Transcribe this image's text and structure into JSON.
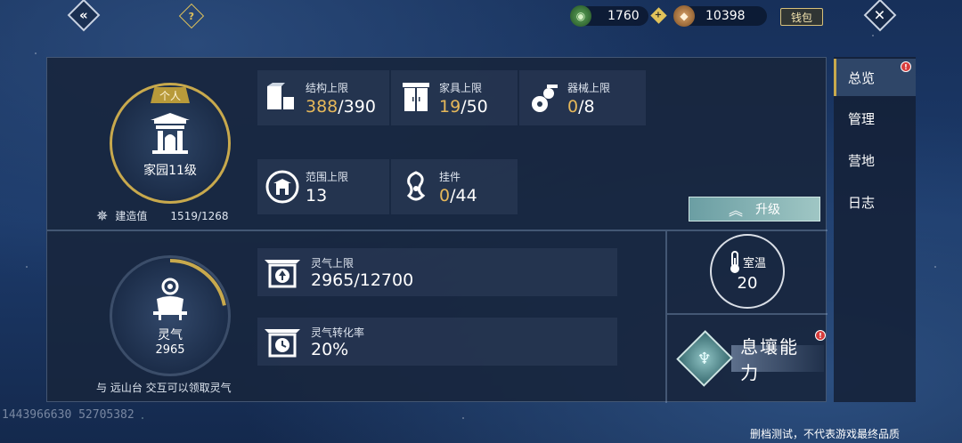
{
  "topbar": {
    "jade_amount": "1760",
    "bean_amount": "10398",
    "wallet_label": "钱包",
    "help_glyph": "?"
  },
  "home": {
    "tag": "个人",
    "level_label": "家园11级",
    "build_label": "建造值",
    "build_value": "1519/1268"
  },
  "stats": {
    "structure": {
      "label": "结构上限",
      "current": "388",
      "max": "/390"
    },
    "furniture": {
      "label": "家具上限",
      "current": "19",
      "max": "/50"
    },
    "machine": {
      "label": "器械上限",
      "current": "0",
      "max": "/8"
    },
    "range": {
      "label": "范围上限",
      "value": "13"
    },
    "pendant": {
      "label": "挂件",
      "current": "0",
      "max": "/44"
    }
  },
  "upgrade": {
    "label": "升级"
  },
  "spirit": {
    "label": "灵气",
    "value": "2965",
    "fill_fraction": 0.22,
    "hint": "与 远山台 交互可以领取灵气",
    "cap_label": "灵气上限",
    "cap_value": "2965/12700",
    "rate_label": "灵气转化率",
    "rate_value": "20%"
  },
  "temperature": {
    "label": "室温",
    "value": "20"
  },
  "ability": {
    "label": "息壤能力"
  },
  "tabs": [
    {
      "label": "总览",
      "active": true
    },
    {
      "label": "管理",
      "active": false
    },
    {
      "label": "营地",
      "active": false
    },
    {
      "label": "日志",
      "active": false
    }
  ],
  "footer": {
    "id": "1443966630 52705382",
    "note": "删档测试，不代表游戏最终品质"
  },
  "colors": {
    "gold": "#e6b85a",
    "accent_teal": "#9fc6c4",
    "alert_red": "#d63c3c"
  }
}
